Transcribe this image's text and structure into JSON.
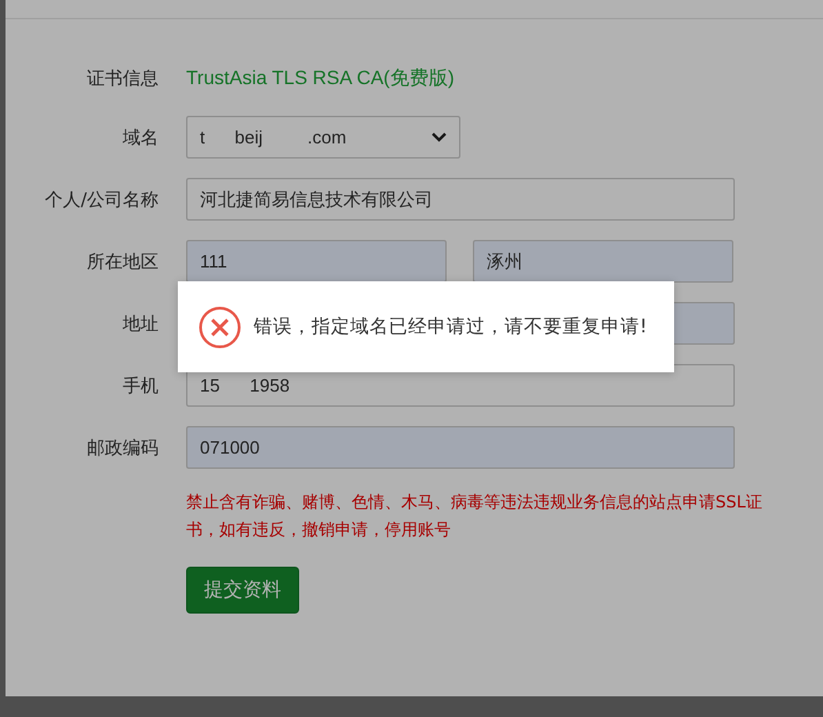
{
  "certificate": {
    "label": "证书信息",
    "value": "TrustAsia TLS RSA CA(免费版)"
  },
  "fields": [
    {
      "kind": "select",
      "label": "域名",
      "inputs": [
        {
          "value": "t      beij         .com",
          "autofilled": false
        }
      ]
    },
    {
      "kind": "text",
      "label": "个人/公司名称",
      "inputs": [
        {
          "value": "河北捷简易信息技术有限公司",
          "autofilled": false
        }
      ]
    },
    {
      "kind": "pair",
      "label": "所在地区",
      "inputs": [
        {
          "value": "111",
          "autofilled": true
        },
        {
          "value": "涿州",
          "autofilled": true
        }
      ]
    },
    {
      "kind": "text",
      "label": "地址",
      "inputs": [
        {
          "autofilled": true
        }
      ]
    },
    {
      "kind": "text",
      "label": "手机",
      "inputs": [
        {
          "value": "15      1958",
          "autofilled": false
        }
      ]
    },
    {
      "kind": "text",
      "label": "邮政编码",
      "inputs": [
        {
          "value": "071000",
          "autofilled": true
        }
      ]
    }
  ],
  "warning": "禁止含有诈骗、赌博、色情、木马、病毒等违法违规业务信息的站点申请SSL证书，如有违反，撤销申请，停用账号",
  "submit_button": "提交资料",
  "dialog": {
    "kind": "error",
    "message": "错误，指定域名已经申请过，请不要重复申请!"
  }
}
